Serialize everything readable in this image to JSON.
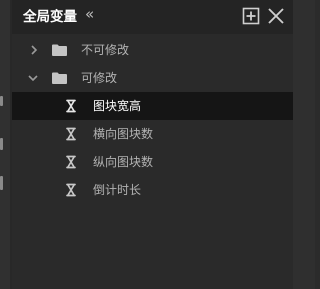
{
  "panel": {
    "title": "全局变量",
    "collapse_glyph": "«",
    "add_icon": "add-square-icon",
    "close_icon": "close-icon"
  },
  "tree": {
    "groups": [
      {
        "label": "不可修改",
        "expanded": false,
        "icon": "folder-icon"
      },
      {
        "label": "可修改",
        "expanded": true,
        "icon": "folder-icon"
      }
    ],
    "variables": [
      {
        "label": "图块宽高",
        "icon": "variable-x-icon",
        "selected": true
      },
      {
        "label": "横向图块数",
        "icon": "variable-x-icon",
        "selected": false
      },
      {
        "label": "纵向图块数",
        "icon": "variable-x-icon",
        "selected": false
      },
      {
        "label": "倒计时长",
        "icon": "variable-x-icon",
        "selected": false
      }
    ]
  },
  "colors": {
    "panel_bg": "#2a2a2a",
    "header_bg": "#242424",
    "selected_row_bg": "#151515",
    "text": "#b3b3b3",
    "text_selected": "#ffffff"
  }
}
